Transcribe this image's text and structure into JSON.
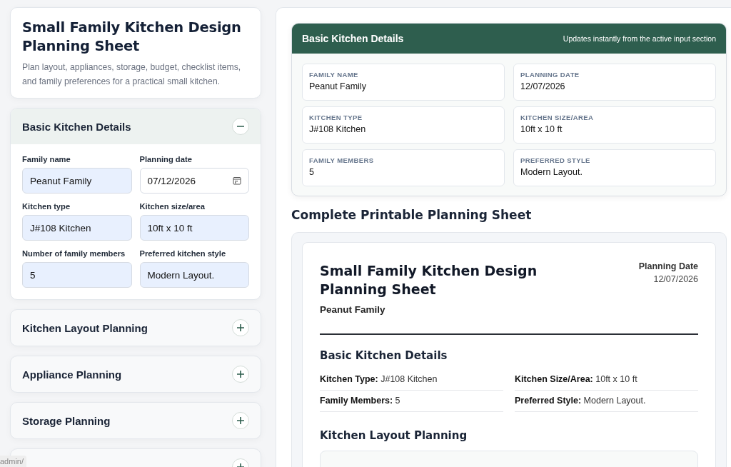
{
  "header": {
    "title": "Small Family Kitchen Design Planning Sheet",
    "subtitle": "Plan layout, appliances, storage, budget, checklist items, and family preferences for a practical small kitchen."
  },
  "sections": [
    {
      "title": "Basic Kitchen Details",
      "expanded": true,
      "fields": [
        {
          "label": "Family name",
          "value": "Peanut Family",
          "kind": "text"
        },
        {
          "label": "Planning date",
          "value": "07/12/2026",
          "kind": "date"
        },
        {
          "label": "Kitchen type",
          "value": "J#108 Kitchen",
          "kind": "text"
        },
        {
          "label": "Kitchen size/area",
          "value": "10ft x 10 ft",
          "kind": "text"
        },
        {
          "label": "Number of family members",
          "value": "5",
          "kind": "text"
        },
        {
          "label": "Preferred kitchen style",
          "value": "Modern Layout.",
          "kind": "text"
        }
      ]
    },
    {
      "title": "Kitchen Layout Planning",
      "expanded": false
    },
    {
      "title": "Appliance Planning",
      "expanded": false
    },
    {
      "title": "Storage Planning",
      "expanded": false
    },
    {
      "expanded": false
    }
  ],
  "preview": {
    "title": "Basic Kitchen Details",
    "note": "Updates instantly from the active input section",
    "items": [
      {
        "label": "FAMILY NAME",
        "value": "Peanut Family"
      },
      {
        "label": "PLANNING DATE",
        "value": "12/07/2026"
      },
      {
        "label": "KITCHEN TYPE",
        "value": "J#108 Kitchen"
      },
      {
        "label": "KITCHEN SIZE/AREA",
        "value": "10ft x 10 ft"
      },
      {
        "label": "FAMILY MEMBERS",
        "value": "5"
      },
      {
        "label": "PREFERRED STYLE",
        "value": "Modern Layout."
      }
    ]
  },
  "sheet_heading": "Complete Printable Planning Sheet",
  "sheet": {
    "title": "Small Family Kitchen Design Planning Sheet",
    "family": "Peanut Family",
    "date_label": "Planning Date",
    "date": "12/07/2026",
    "sections": [
      {
        "title": "Basic Kitchen Details",
        "rows": [
          "**Kitchen Type:** J#108 Kitchen",
          "**Kitchen Size/Area:** 10ft x 10 ft",
          "**Family Members:** 5",
          "**Preferred Style:** Modern Layout."
        ]
      },
      {
        "title": "Kitchen Layout Planning",
        "kind": "box"
      }
    ]
  },
  "status_bar": {
    "url": "admin/"
  }
}
